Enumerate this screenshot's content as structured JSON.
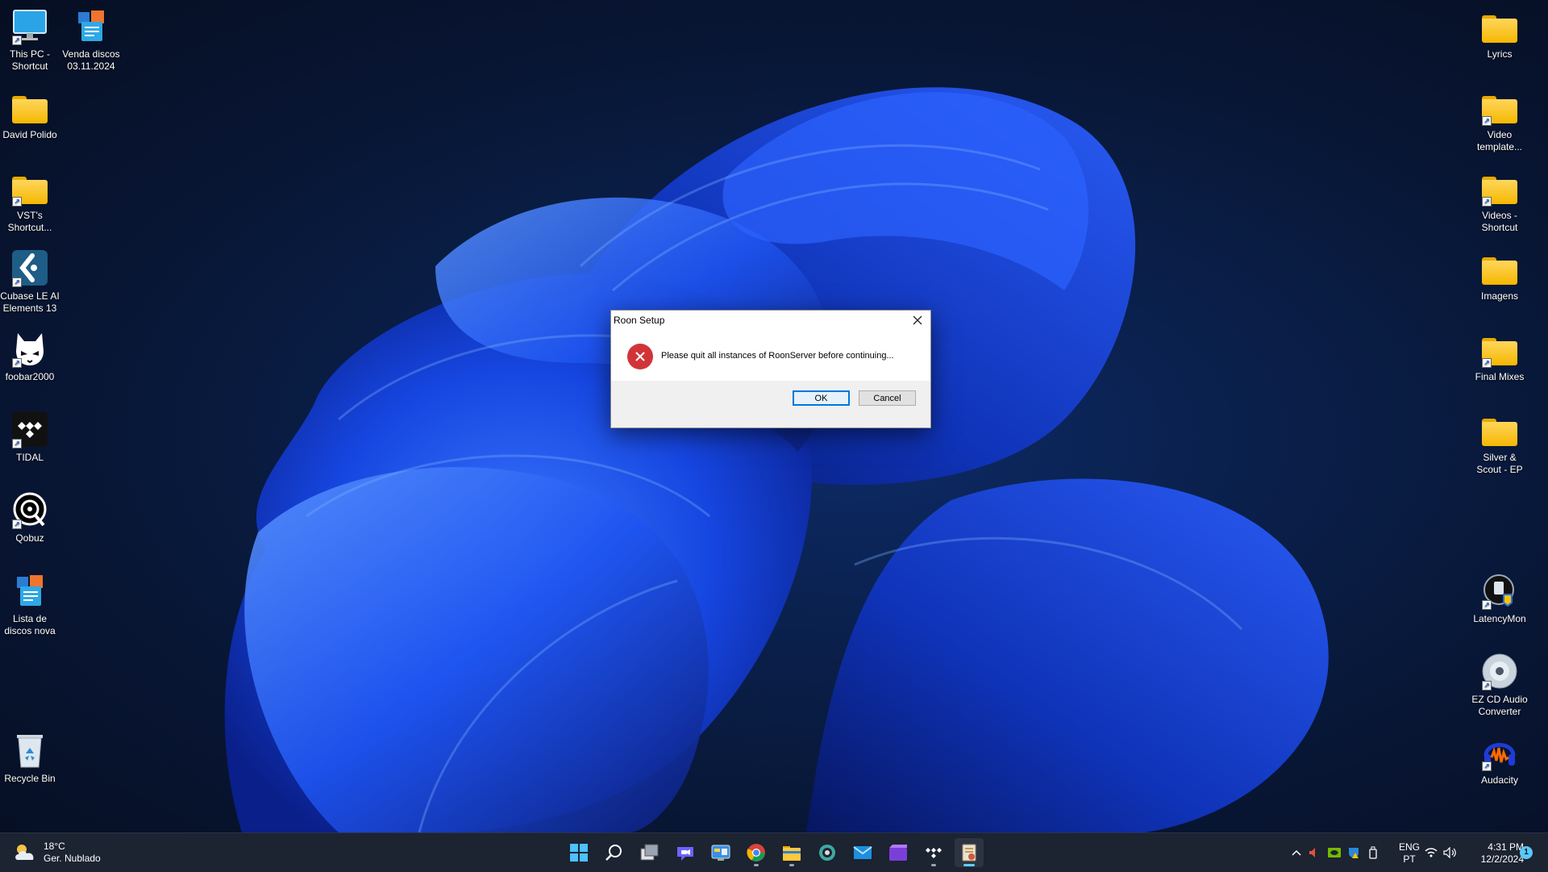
{
  "desktop": {
    "left_icons": [
      {
        "label": "This PC -\nShortcut",
        "icon": "monitor-icon",
        "shortcut": true
      },
      {
        "label": "Venda discos\n03.11.2024",
        "icon": "office-document-icon",
        "shortcut": false
      },
      {
        "label": "David Polido",
        "icon": "folder-icon",
        "shortcut": false
      },
      {
        "label": "VST's\nShortcut...",
        "icon": "folder-icon",
        "shortcut": true
      },
      {
        "label": "Cubase LE AI\nElements 13",
        "icon": "cubase-icon",
        "shortcut": true
      },
      {
        "label": "foobar2000",
        "icon": "foobar-icon",
        "shortcut": true
      },
      {
        "label": "TIDAL",
        "icon": "tidal-icon",
        "shortcut": true
      },
      {
        "label": "Qobuz",
        "icon": "qobuz-icon",
        "shortcut": true
      },
      {
        "label": "Lista de\ndiscos nova",
        "icon": "office-document-icon",
        "shortcut": false
      },
      {
        "label": "Recycle Bin",
        "icon": "recycle-bin-icon",
        "shortcut": false
      }
    ],
    "right_icons": [
      {
        "label": "Lyrics",
        "icon": "folder-icon",
        "shortcut": false
      },
      {
        "label": "Video\ntemplate...",
        "icon": "folder-icon",
        "shortcut": true
      },
      {
        "label": "Videos -\nShortcut",
        "icon": "folder-icon",
        "shortcut": true
      },
      {
        "label": "Imagens",
        "icon": "folder-icon",
        "shortcut": false
      },
      {
        "label": "Final Mixes",
        "icon": "folder-icon",
        "shortcut": true
      },
      {
        "label": "Silver &\nScout - EP",
        "icon": "folder-icon",
        "shortcut": false
      },
      {
        "label": "LatencyMon",
        "icon": "latencymon-icon",
        "shortcut": true
      },
      {
        "label": "EZ CD Audio\nConverter",
        "icon": "cd-icon",
        "shortcut": true
      },
      {
        "label": "Audacity",
        "icon": "audacity-icon",
        "shortcut": true
      }
    ]
  },
  "dialog": {
    "title": "Roon Setup",
    "message": "Please quit all instances of RoonServer before continuing...",
    "ok_label": "OK",
    "cancel_label": "Cancel",
    "icon": "error-icon"
  },
  "taskbar": {
    "weather": {
      "temp": "18°C",
      "condition": "Ger. Nublado"
    },
    "apps": [
      "start-icon",
      "search-icon",
      "task-view-icon",
      "teams-chat-icon",
      "control-panel-icon",
      "chrome-icon",
      "file-explorer-icon",
      "roon-icon",
      "mail-icon",
      "clipchamp-icon",
      "tidal-icon",
      "roon-setup-icon"
    ],
    "language": {
      "line1": "ENG",
      "line2": "PT"
    },
    "clock": {
      "time": "4:31 PM",
      "date": "12/2/2024"
    },
    "notification_count": "1"
  }
}
